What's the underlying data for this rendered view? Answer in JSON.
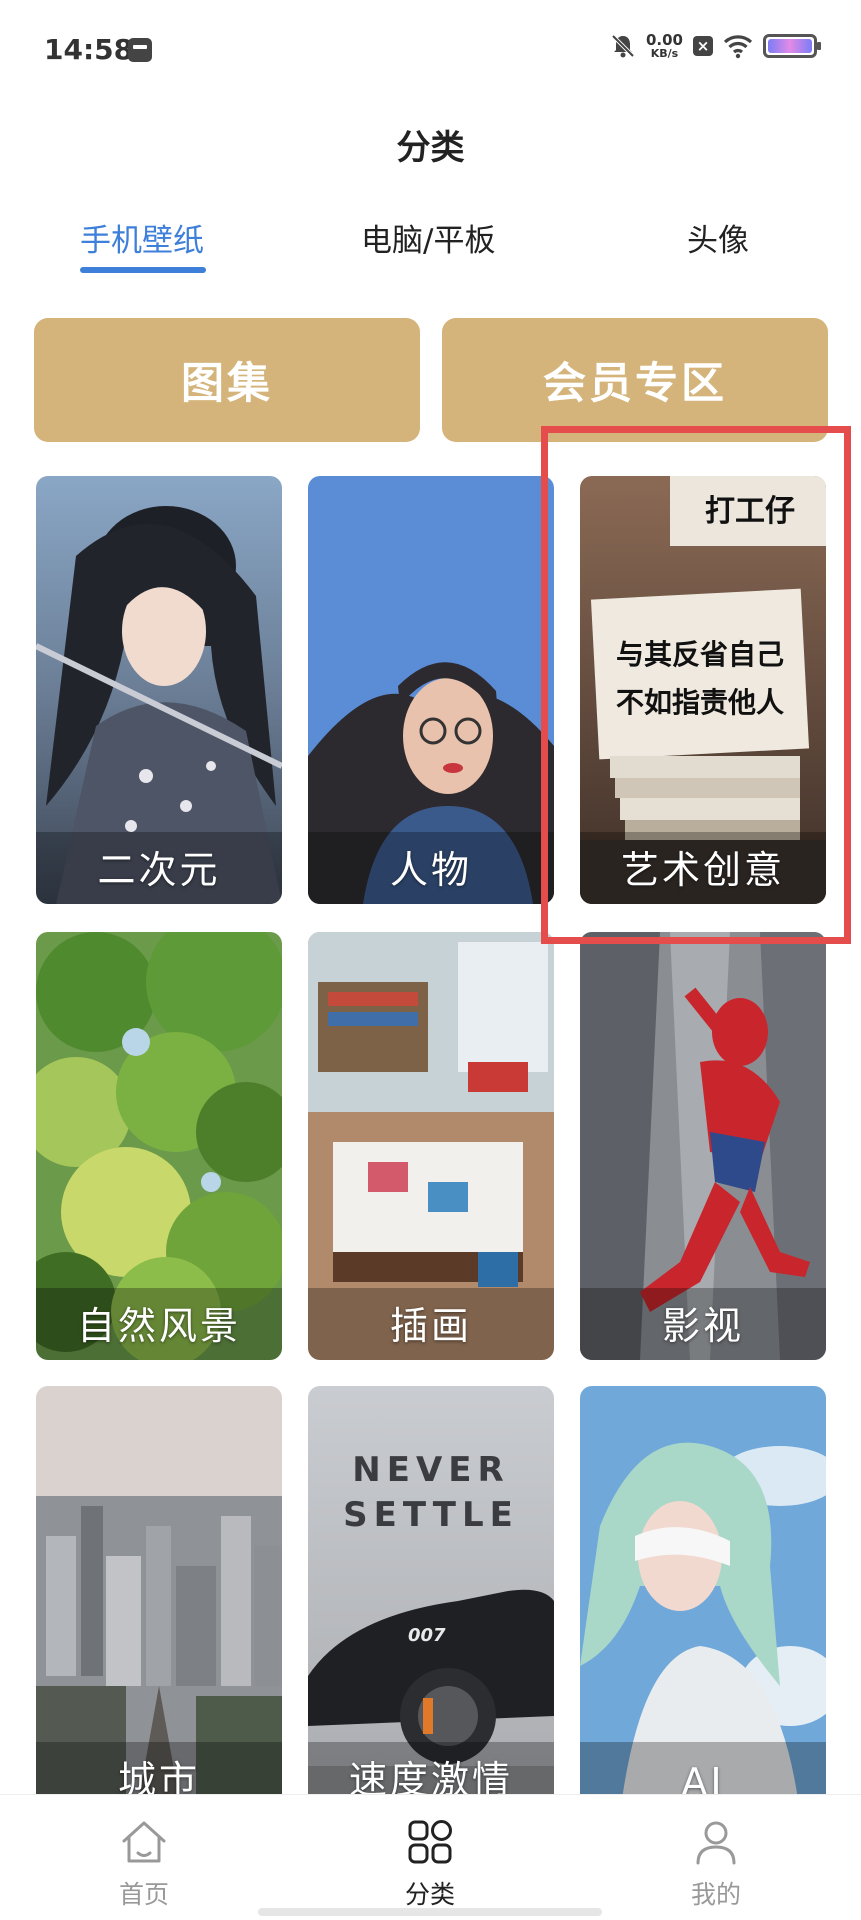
{
  "status_bar": {
    "time": "14:58",
    "net_speed_value": "0.00",
    "net_speed_unit": "KB/s"
  },
  "header": {
    "title": "分类"
  },
  "tabs": [
    {
      "label": "手机壁纸",
      "active": true
    },
    {
      "label": "电脑/平板",
      "active": false
    },
    {
      "label": "头像",
      "active": false
    }
  ],
  "feature_buttons": [
    {
      "label": "图集"
    },
    {
      "label": "会员专区"
    }
  ],
  "categories": [
    {
      "label": "二次元"
    },
    {
      "label": "人物"
    },
    {
      "label": "艺术创意"
    },
    {
      "label": "自然风景"
    },
    {
      "label": "插画"
    },
    {
      "label": "影视"
    },
    {
      "label": "城市"
    },
    {
      "label": "速度激情"
    },
    {
      "label": "AI"
    }
  ],
  "art_text": {
    "calligraphy_line1": "与其反省自己",
    "calligraphy_line2": "不如指责他人",
    "sign_top": "打工仔",
    "car_text_line1": "NEVER",
    "car_text_line2": "SETTLE",
    "car_number": "007"
  },
  "bottom_nav": [
    {
      "label": "首页",
      "icon": "home-icon",
      "active": false
    },
    {
      "label": "分类",
      "icon": "grid-icon",
      "active": true
    },
    {
      "label": "我的",
      "icon": "user-icon",
      "active": false
    }
  ],
  "colors": {
    "accent": "#3d7fd9",
    "gold": "#d4b47a",
    "highlight": "#e54d4d"
  }
}
